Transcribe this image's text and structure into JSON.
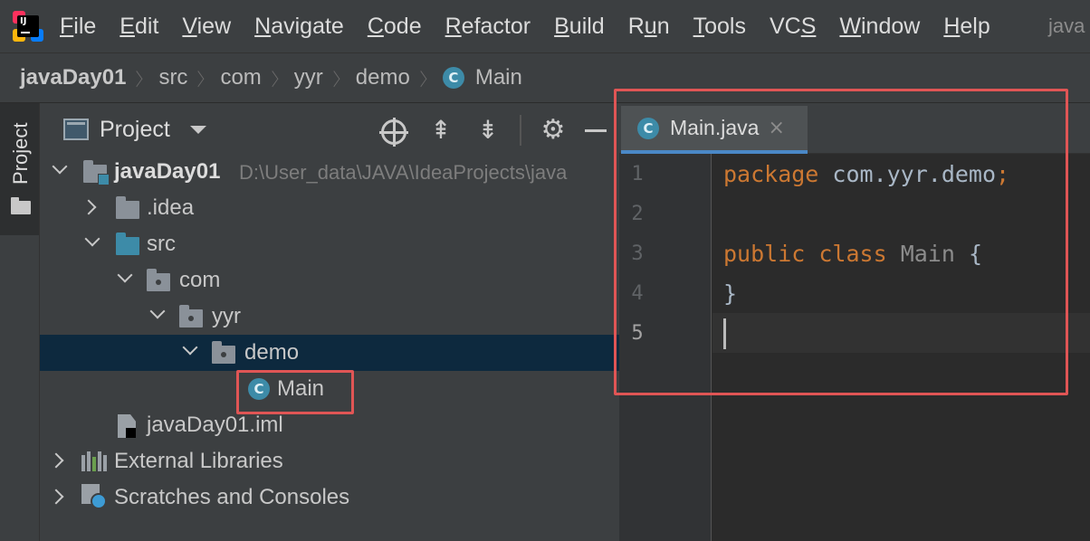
{
  "menubar": {
    "items": [
      {
        "label": "File",
        "mnemonic": "F",
        "rest": "ile"
      },
      {
        "label": "Edit",
        "mnemonic": "E",
        "rest": "dit"
      },
      {
        "label": "View",
        "mnemonic": "V",
        "rest": "iew"
      },
      {
        "label": "Navigate",
        "mnemonic": "N",
        "rest": "avigate"
      },
      {
        "label": "Code",
        "mnemonic": "C",
        "rest": "ode"
      },
      {
        "label": "Refactor",
        "mnemonic": "R",
        "rest": "efactor"
      },
      {
        "label": "Build",
        "mnemonic": "B",
        "rest": "uild"
      },
      {
        "label": "Run",
        "pre": "R",
        "mnemonic": "u",
        "rest": "n"
      },
      {
        "label": "Tools",
        "mnemonic": "T",
        "rest": "ools"
      },
      {
        "label": "VCS",
        "pre": "VC",
        "mnemonic": "S",
        "rest": ""
      },
      {
        "label": "Window",
        "mnemonic": "W",
        "rest": "indow"
      },
      {
        "label": "Help",
        "mnemonic": "H",
        "rest": "elp"
      }
    ],
    "window_title": "java",
    "logo_text": "IJ"
  },
  "breadcrumb": [
    "javaDay01",
    "src",
    "com",
    "yyr",
    "demo",
    "Main"
  ],
  "toolstrip": {
    "label": "Project"
  },
  "project_panel": {
    "title": "Project",
    "tree": {
      "root": {
        "label": "javaDay01",
        "path": "D:\\User_data\\JAVA\\IdeaProjects\\java"
      },
      "idea": ".idea",
      "src": "src",
      "com": "com",
      "yyr": "yyr",
      "demo": "demo",
      "main": "Main",
      "iml": "javaDay01.iml",
      "libs": "External Libraries",
      "scratches": "Scratches and Consoles"
    }
  },
  "editor": {
    "tab": {
      "label": "Main.java",
      "close": "×"
    },
    "line_numbers": [
      "1",
      "2",
      "3",
      "4",
      "5"
    ],
    "code": {
      "l1_kw": "package",
      "l1_rest": " com.yyr.demo",
      "l1_semi": ";",
      "l3_kw1": "public",
      "l3_kw2": "class",
      "l3_name": " Main ",
      "l3_brace": "{",
      "l4": "}"
    }
  },
  "icons": {
    "class": "C",
    "gear": "⚙",
    "expand": "⇞",
    "collapse": "⇟"
  },
  "colors": {
    "keyword": "#cc7832",
    "selection": "#0d293e",
    "highlight_box": "#e05555",
    "class_icon": "#3d8ba8"
  }
}
